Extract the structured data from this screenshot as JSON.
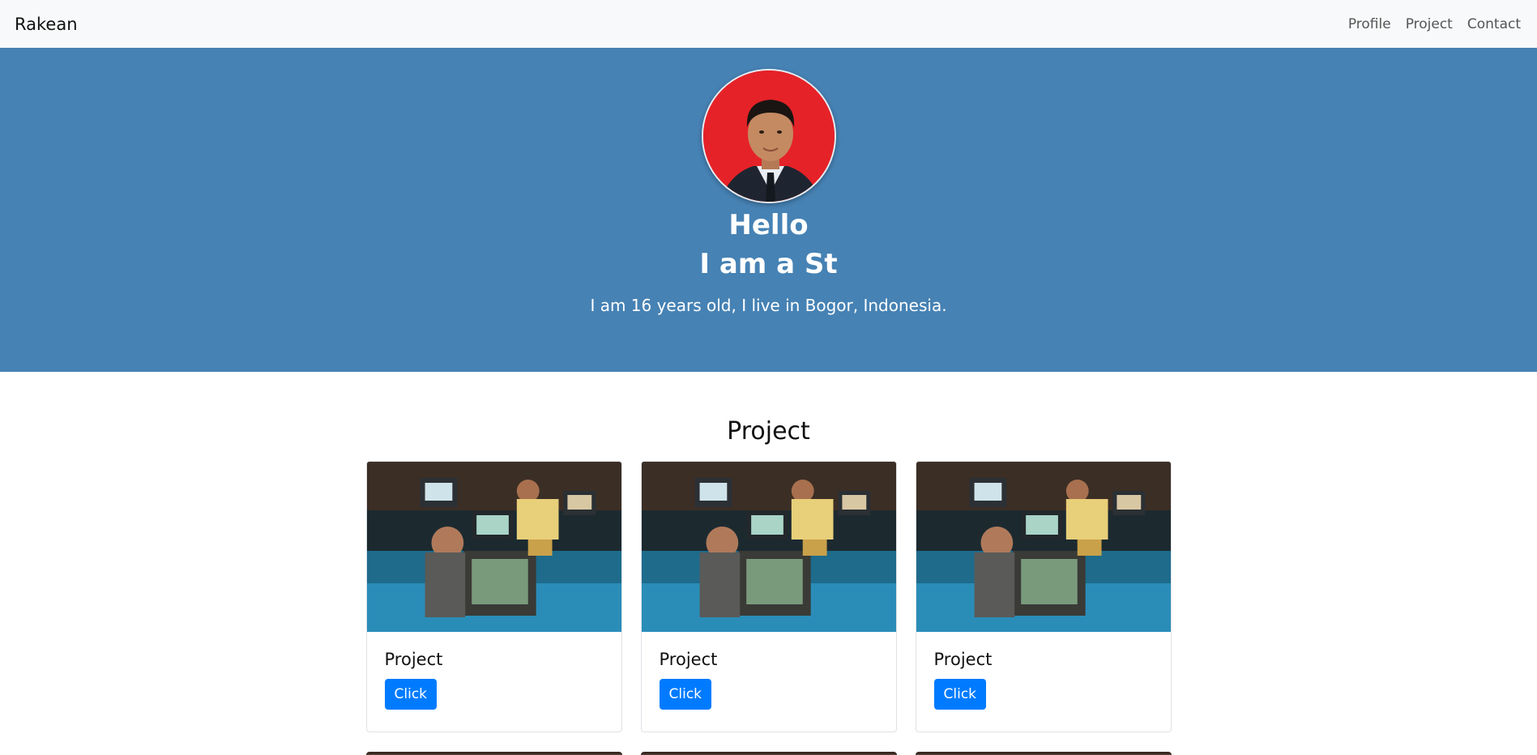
{
  "navbar": {
    "brand": "Rakean",
    "links": [
      "Profile",
      "Project",
      "Contact"
    ]
  },
  "hero": {
    "greeting": "Hello",
    "subtitle": "I am a St",
    "description": "I am 16 years old, I live in Bogor, Indonesia."
  },
  "projects": {
    "title": "Project",
    "cards": [
      {
        "title": "Project",
        "button": "Click"
      },
      {
        "title": "Project",
        "button": "Click"
      },
      {
        "title": "Project",
        "button": "Click"
      }
    ]
  },
  "colors": {
    "hero_bg": "#4682b4",
    "navbar_bg": "#f8f9fa",
    "button": "#007bff"
  }
}
